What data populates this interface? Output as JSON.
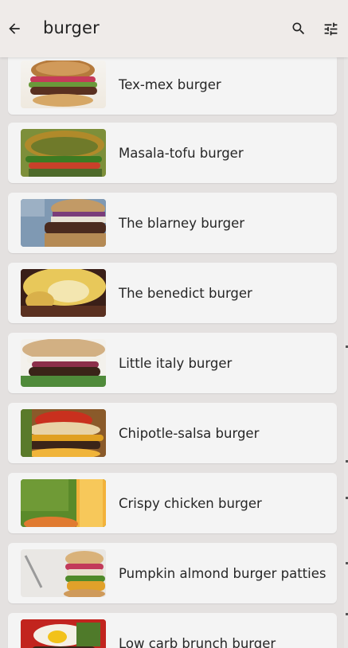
{
  "header": {
    "title": "burger",
    "back_icon": "arrow-back-icon",
    "search_icon": "search-icon",
    "filter_icon": "tune-icon"
  },
  "results": [
    {
      "label": "Tex-mex burger",
      "image": "tex-mex-burger-photo"
    },
    {
      "label": "Masala-tofu burger",
      "image": "masala-tofu-burger-photo"
    },
    {
      "label": "The blarney burger",
      "image": "blarney-burger-photo"
    },
    {
      "label": "The benedict burger",
      "image": "benedict-burger-photo"
    },
    {
      "label": "Little italy burger",
      "image": "little-italy-burger-photo"
    },
    {
      "label": "Chipotle-salsa burger",
      "image": "chipotle-salsa-burger-photo"
    },
    {
      "label": "Crispy chicken burger",
      "image": "crispy-chicken-burger-photo"
    },
    {
      "label": "Pumpkin almond burger patties",
      "image": "pumpkin-almond-burger-photo"
    },
    {
      "label": "Low carb brunch burger",
      "image": "low-carb-brunch-burger-photo"
    }
  ]
}
